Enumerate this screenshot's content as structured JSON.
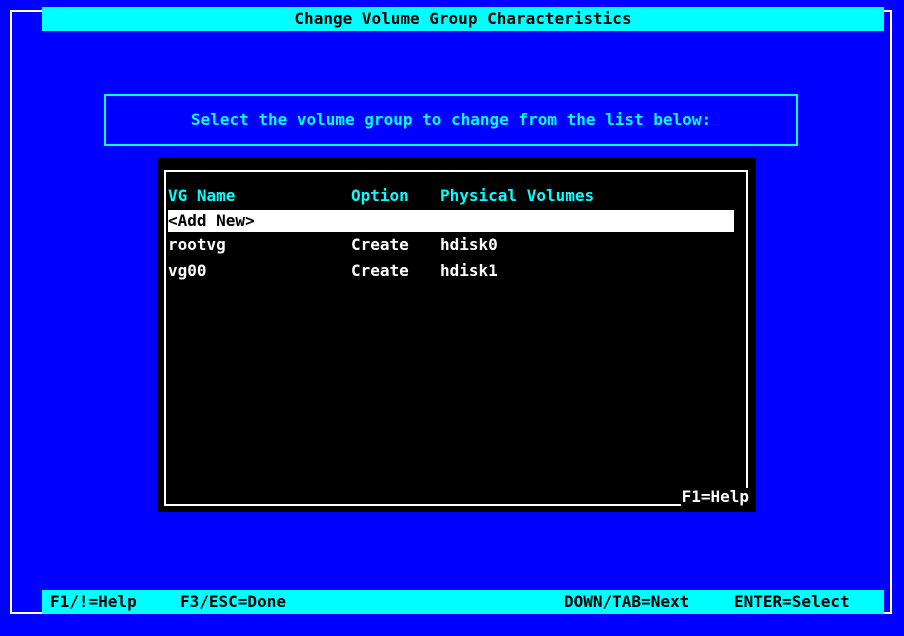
{
  "title": "Change Volume Group Characteristics",
  "prompt": "Select the volume group to change from the list below:",
  "list": {
    "columns": [
      "VG Name",
      "Option",
      "Physical Volumes"
    ],
    "rows": [
      {
        "vg_name": "<Add New>",
        "option": "",
        "pv": ""
      },
      {
        "vg_name": "rootvg",
        "option": "Create",
        "pv": "hdisk0"
      },
      {
        "vg_name": "vg00",
        "option": "Create",
        "pv": "hdisk1"
      }
    ],
    "help": "F1=Help"
  },
  "status": {
    "help": "F1/!=Help",
    "done": "F3/ESC=Done",
    "next": "DOWN/TAB=Next",
    "select": "ENTER=Select"
  }
}
